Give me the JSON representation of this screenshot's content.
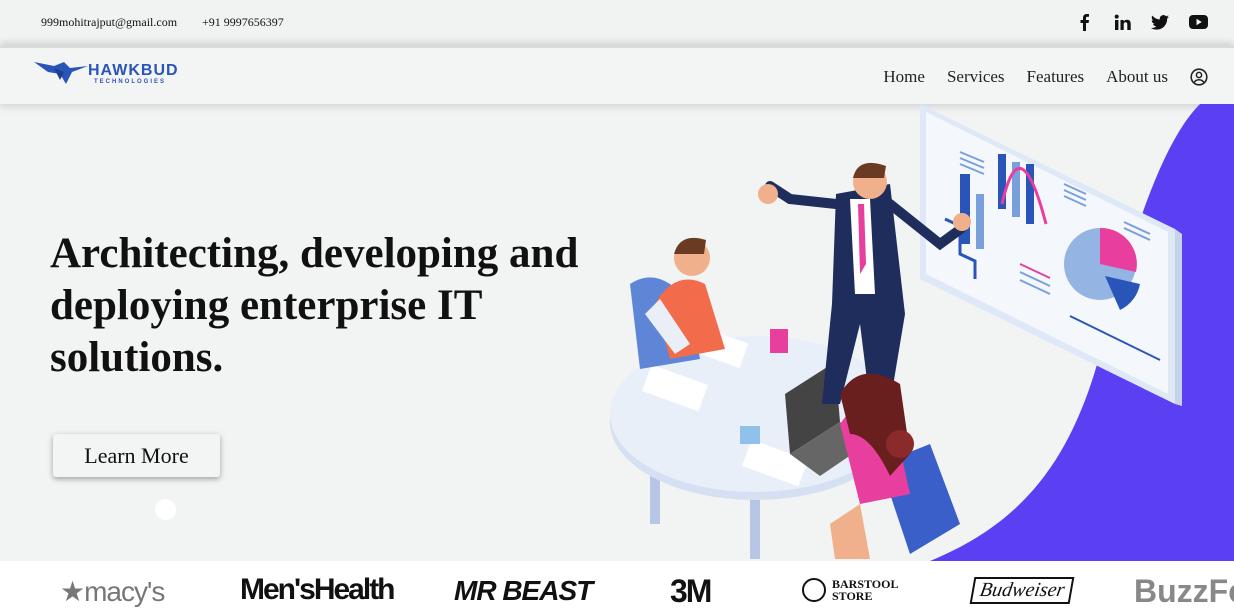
{
  "topbar": {
    "email": "999mohitrajput@gmail.com",
    "phone": "+91 9997656397",
    "social": [
      "facebook-icon",
      "linkedin-icon",
      "twitter-icon",
      "youtube-icon"
    ]
  },
  "navbar": {
    "brand": "HAWKBUD",
    "brand_sub": "TECHNOLOGIES",
    "links": [
      "Home",
      "Services",
      "Features",
      "About us"
    ],
    "user_icon": "user-circle-icon"
  },
  "hero": {
    "title": "Architecting, developing and deploying enterprise IT solutions.",
    "cta": "Learn More"
  },
  "brands": [
    "macy's",
    "Men'sHealth",
    "MR BEAST",
    "3M",
    "BARSTOOL STORE",
    "Budweiser",
    "BuzzFe"
  ],
  "colors": {
    "accent_purple": "#5b3ff2",
    "brand_blue": "#2a55b8",
    "pink": "#e83f9e",
    "orange": "#f26b4a"
  }
}
